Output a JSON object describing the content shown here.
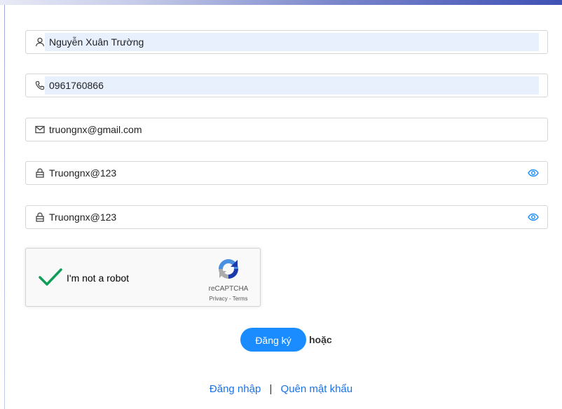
{
  "form": {
    "name_value": "Nguyễn Xuân Trường",
    "phone_value": "0961760866",
    "email_value": "truongnx@gmail.com",
    "password_value": "Truongnx@123",
    "confirm_password_value": "Truongnx@123"
  },
  "captcha": {
    "label": "I'm not a robot",
    "brand": "reCAPTCHA",
    "privacy": "Privacy",
    "separator": "-",
    "terms": "Terms"
  },
  "actions": {
    "register_label": "Đăng ký",
    "or_label": "hoặc",
    "login_label": "Đăng nhập",
    "link_separator": "|",
    "forgot_password_label": "Quên mật khẩu"
  },
  "icons": {
    "name": "user-icon",
    "phone": "phone-icon",
    "email": "mail-icon",
    "password": "lock-icon",
    "show_password": "eye-icon",
    "checkmark": "check-icon",
    "recaptcha": "recaptcha-logo"
  },
  "colors": {
    "primary": "#1a8cff",
    "link": "#1a73e8",
    "autofill": "#e8f0fe",
    "check": "#0f9d58",
    "eye": "#1a8cff"
  }
}
